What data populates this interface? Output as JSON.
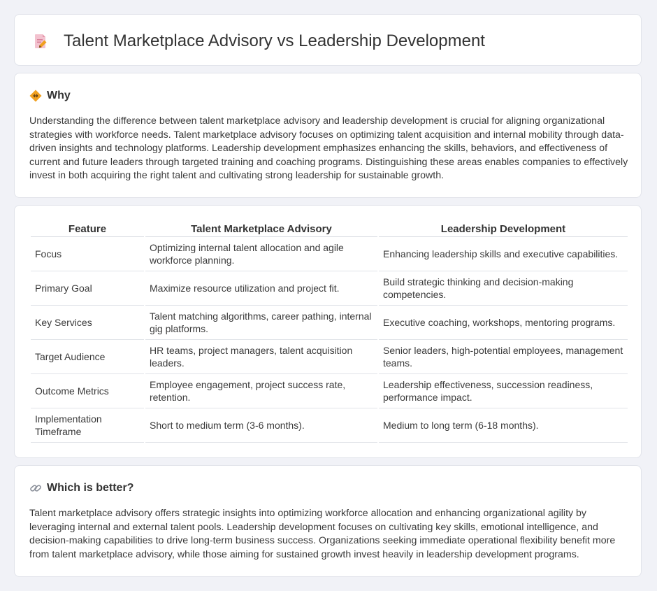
{
  "page": {
    "title": "Talent Marketplace Advisory vs Leadership Development"
  },
  "why": {
    "heading": "Why",
    "text": "Understanding the difference between talent marketplace advisory and leadership development is crucial for aligning organizational strategies with workforce needs. Talent marketplace advisory focuses on optimizing talent acquisition and internal mobility through data-driven insights and technology platforms. Leadership development emphasizes enhancing the skills, behaviors, and effectiveness of current and future leaders through targeted training and coaching programs. Distinguishing these areas enables companies to effectively invest in both acquiring the right talent and cultivating strong leadership for sustainable growth."
  },
  "table": {
    "headers": [
      "Feature",
      "Talent Marketplace Advisory",
      "Leadership Development"
    ],
    "rows": [
      [
        "Focus",
        "Optimizing internal talent allocation and agile workforce planning.",
        "Enhancing leadership skills and executive capabilities."
      ],
      [
        "Primary Goal",
        "Maximize resource utilization and project fit.",
        "Build strategic thinking and decision-making competencies."
      ],
      [
        "Key Services",
        "Talent matching algorithms, career pathing, internal gig platforms.",
        "Executive coaching, workshops, mentoring programs."
      ],
      [
        "Target Audience",
        "HR teams, project managers, talent acquisition leaders.",
        "Senior leaders, high-potential employees, management teams."
      ],
      [
        "Outcome Metrics",
        "Employee engagement, project success rate, retention.",
        "Leadership effectiveness, succession readiness, performance impact."
      ],
      [
        "Implementation Timeframe",
        "Short to medium term (3-6 months).",
        "Medium to long term (6-18 months)."
      ]
    ]
  },
  "better": {
    "heading": "Which is better?",
    "text": "Talent marketplace advisory offers strategic insights into optimizing workforce allocation and enhancing organizational agility by leveraging internal and external talent pools. Leadership development focuses on cultivating key skills, emotional intelligence, and decision-making capabilities to drive long-term business success. Organizations seeking immediate operational flexibility benefit more from talent marketplace advisory, while those aiming for sustained growth invest heavily in leadership development programs."
  },
  "icons": {
    "title": "document-pencil-icon",
    "why": "diamond-arrows-icon",
    "better": "link-icon"
  },
  "colors": {
    "background": "#f1f2f7",
    "card": "#ffffff",
    "accent_orange": "#f0a020",
    "icon_pink": "#e8a0b4"
  }
}
